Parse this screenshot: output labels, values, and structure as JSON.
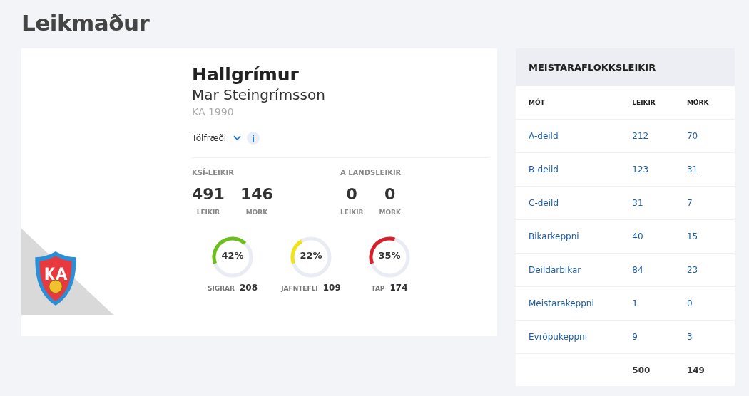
{
  "page_title": "Leikmaður",
  "player": {
    "first_name": "Hallgrímur",
    "last_name": "Mar Steingrímsson",
    "club_year": "KA 1990",
    "stats_label": "Tölfræði"
  },
  "stat_groups": [
    {
      "title": "KSÍ-LEIKIR",
      "items": [
        {
          "value": "491",
          "label": "LEIKIR"
        },
        {
          "value": "146",
          "label": "MÖRK"
        }
      ]
    },
    {
      "title": "A LANDSLEIKIR",
      "items": [
        {
          "value": "0",
          "label": "LEIKIR"
        },
        {
          "value": "0",
          "label": "MÖRK"
        }
      ]
    }
  ],
  "results": [
    {
      "percent": "42%",
      "level": 0.42,
      "color": "#6cbf1b",
      "label": "SIGRAR",
      "count": "208"
    },
    {
      "percent": "22%",
      "level": 0.22,
      "color": "#f2e21a",
      "label": "JAFNTEFLI",
      "count": "109"
    },
    {
      "percent": "35%",
      "level": 0.35,
      "color": "#d81f2c",
      "label": "TAP",
      "count": "174"
    }
  ],
  "table": {
    "title": "MEISTARAFLOKKSLEIKIR",
    "columns": [
      "MÓT",
      "LEIKIR",
      "MÖRK"
    ],
    "rows": [
      [
        "A-deild",
        "212",
        "70"
      ],
      [
        "B-deild",
        "123",
        "31"
      ],
      [
        "C-deild",
        "31",
        "7"
      ],
      [
        "Bikarkeppni",
        "40",
        "15"
      ],
      [
        "Deildarbikar",
        "84",
        "23"
      ],
      [
        "Meistarakeppni",
        "1",
        "0"
      ],
      [
        "Evrópukeppni",
        "9",
        "3"
      ]
    ],
    "totals": [
      "500",
      "149"
    ]
  }
}
